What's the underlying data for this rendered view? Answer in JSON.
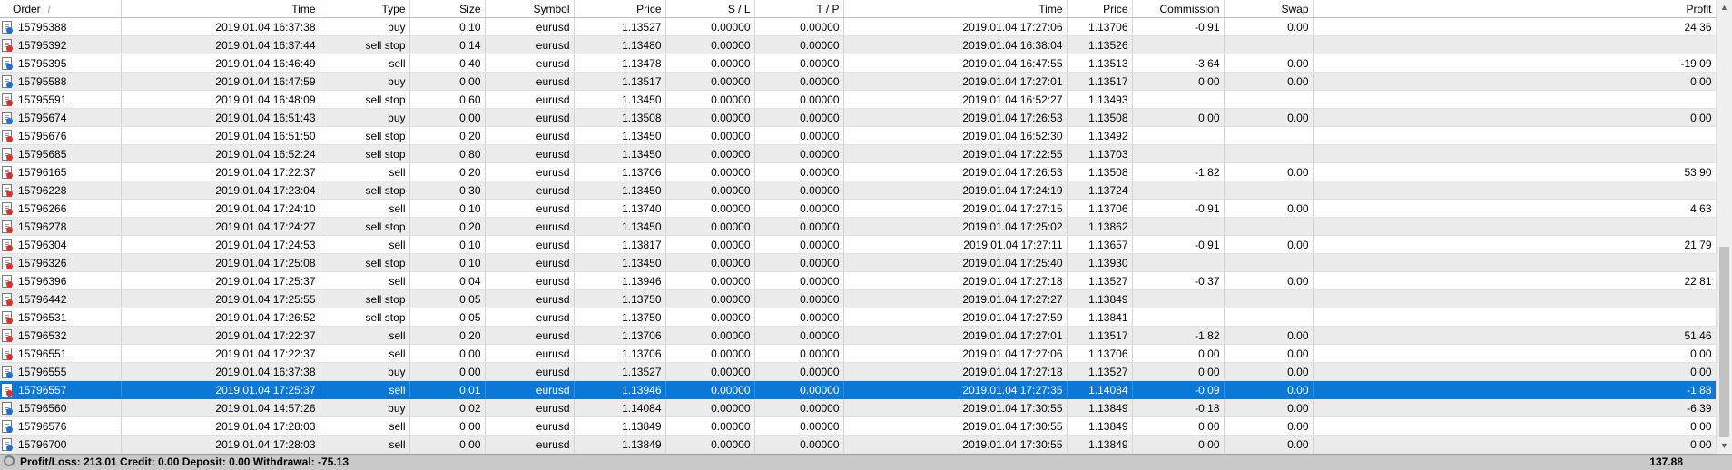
{
  "columns": {
    "order": "Order",
    "sort_indicator": "/",
    "time": "Time",
    "type": "Type",
    "size": "Size",
    "symbol": "Symbol",
    "price": "Price",
    "sl": "S / L",
    "tp": "T / P",
    "close_time": "Time",
    "close_price": "Price",
    "commission": "Commission",
    "swap": "Swap",
    "profit": "Profit"
  },
  "rows": [
    {
      "side": "buy",
      "order": "15795388",
      "time": "2019.01.04 16:37:38",
      "type": "buy",
      "size": "0.10",
      "symbol": "eurusd",
      "price": "1.13527",
      "sl": "0.00000",
      "tp": "0.00000",
      "close_time": "2019.01.04 17:27:06",
      "close_price": "1.13706",
      "commission": "-0.91",
      "swap": "0.00",
      "profit": "24.36"
    },
    {
      "side": "sell",
      "order": "15795392",
      "time": "2019.01.04 16:37:44",
      "type": "sell stop",
      "size": "0.14",
      "symbol": "eurusd",
      "price": "1.13480",
      "sl": "0.00000",
      "tp": "0.00000",
      "close_time": "2019.01.04 16:38:04",
      "close_price": "1.13526",
      "commission": "",
      "swap": "",
      "profit": ""
    },
    {
      "side": "buy",
      "order": "15795395",
      "time": "2019.01.04 16:46:49",
      "type": "sell",
      "size": "0.40",
      "symbol": "eurusd",
      "price": "1.13478",
      "sl": "0.00000",
      "tp": "0.00000",
      "close_time": "2019.01.04 16:47:55",
      "close_price": "1.13513",
      "commission": "-3.64",
      "swap": "0.00",
      "profit": "-19.09"
    },
    {
      "side": "buy",
      "order": "15795588",
      "time": "2019.01.04 16:47:59",
      "type": "buy",
      "size": "0.00",
      "symbol": "eurusd",
      "price": "1.13517",
      "sl": "0.00000",
      "tp": "0.00000",
      "close_time": "2019.01.04 17:27:01",
      "close_price": "1.13517",
      "commission": "0.00",
      "swap": "0.00",
      "profit": "0.00"
    },
    {
      "side": "sell",
      "order": "15795591",
      "time": "2019.01.04 16:48:09",
      "type": "sell stop",
      "size": "0.60",
      "symbol": "eurusd",
      "price": "1.13450",
      "sl": "0.00000",
      "tp": "0.00000",
      "close_time": "2019.01.04 16:52:27",
      "close_price": "1.13493",
      "commission": "",
      "swap": "",
      "profit": ""
    },
    {
      "side": "buy",
      "order": "15795674",
      "time": "2019.01.04 16:51:43",
      "type": "buy",
      "size": "0.00",
      "symbol": "eurusd",
      "price": "1.13508",
      "sl": "0.00000",
      "tp": "0.00000",
      "close_time": "2019.01.04 17:26:53",
      "close_price": "1.13508",
      "commission": "0.00",
      "swap": "0.00",
      "profit": "0.00"
    },
    {
      "side": "sell",
      "order": "15795676",
      "time": "2019.01.04 16:51:50",
      "type": "sell stop",
      "size": "0.20",
      "symbol": "eurusd",
      "price": "1.13450",
      "sl": "0.00000",
      "tp": "0.00000",
      "close_time": "2019.01.04 16:52:30",
      "close_price": "1.13492",
      "commission": "",
      "swap": "",
      "profit": ""
    },
    {
      "side": "sell",
      "order": "15795685",
      "time": "2019.01.04 16:52:24",
      "type": "sell stop",
      "size": "0.80",
      "symbol": "eurusd",
      "price": "1.13450",
      "sl": "0.00000",
      "tp": "0.00000",
      "close_time": "2019.01.04 17:22:55",
      "close_price": "1.13703",
      "commission": "",
      "swap": "",
      "profit": ""
    },
    {
      "side": "sell",
      "order": "15796165",
      "time": "2019.01.04 17:22:37",
      "type": "sell",
      "size": "0.20",
      "symbol": "eurusd",
      "price": "1.13706",
      "sl": "0.00000",
      "tp": "0.00000",
      "close_time": "2019.01.04 17:26:53",
      "close_price": "1.13508",
      "commission": "-1.82",
      "swap": "0.00",
      "profit": "53.90"
    },
    {
      "side": "sell",
      "order": "15796228",
      "time": "2019.01.04 17:23:04",
      "type": "sell stop",
      "size": "0.30",
      "symbol": "eurusd",
      "price": "1.13450",
      "sl": "0.00000",
      "tp": "0.00000",
      "close_time": "2019.01.04 17:24:19",
      "close_price": "1.13724",
      "commission": "",
      "swap": "",
      "profit": ""
    },
    {
      "side": "sell",
      "order": "15796266",
      "time": "2019.01.04 17:24:10",
      "type": "sell",
      "size": "0.10",
      "symbol": "eurusd",
      "price": "1.13740",
      "sl": "0.00000",
      "tp": "0.00000",
      "close_time": "2019.01.04 17:27:15",
      "close_price": "1.13706",
      "commission": "-0.91",
      "swap": "0.00",
      "profit": "4.63"
    },
    {
      "side": "sell",
      "order": "15796278",
      "time": "2019.01.04 17:24:27",
      "type": "sell stop",
      "size": "0.20",
      "symbol": "eurusd",
      "price": "1.13450",
      "sl": "0.00000",
      "tp": "0.00000",
      "close_time": "2019.01.04 17:25:02",
      "close_price": "1.13862",
      "commission": "",
      "swap": "",
      "profit": ""
    },
    {
      "side": "sell",
      "order": "15796304",
      "time": "2019.01.04 17:24:53",
      "type": "sell",
      "size": "0.10",
      "symbol": "eurusd",
      "price": "1.13817",
      "sl": "0.00000",
      "tp": "0.00000",
      "close_time": "2019.01.04 17:27:11",
      "close_price": "1.13657",
      "commission": "-0.91",
      "swap": "0.00",
      "profit": "21.79"
    },
    {
      "side": "sell",
      "order": "15796326",
      "time": "2019.01.04 17:25:08",
      "type": "sell stop",
      "size": "0.10",
      "symbol": "eurusd",
      "price": "1.13450",
      "sl": "0.00000",
      "tp": "0.00000",
      "close_time": "2019.01.04 17:25:40",
      "close_price": "1.13930",
      "commission": "",
      "swap": "",
      "profit": ""
    },
    {
      "side": "sell",
      "order": "15796396",
      "time": "2019.01.04 17:25:37",
      "type": "sell",
      "size": "0.04",
      "symbol": "eurusd",
      "price": "1.13946",
      "sl": "0.00000",
      "tp": "0.00000",
      "close_time": "2019.01.04 17:27:18",
      "close_price": "1.13527",
      "commission": "-0.37",
      "swap": "0.00",
      "profit": "22.81"
    },
    {
      "side": "sell",
      "order": "15796442",
      "time": "2019.01.04 17:25:55",
      "type": "sell stop",
      "size": "0.05",
      "symbol": "eurusd",
      "price": "1.13750",
      "sl": "0.00000",
      "tp": "0.00000",
      "close_time": "2019.01.04 17:27:27",
      "close_price": "1.13849",
      "commission": "",
      "swap": "",
      "profit": ""
    },
    {
      "side": "sell",
      "order": "15796531",
      "time": "2019.01.04 17:26:52",
      "type": "sell stop",
      "size": "0.05",
      "symbol": "eurusd",
      "price": "1.13750",
      "sl": "0.00000",
      "tp": "0.00000",
      "close_time": "2019.01.04 17:27:59",
      "close_price": "1.13841",
      "commission": "",
      "swap": "",
      "profit": ""
    },
    {
      "side": "sell",
      "order": "15796532",
      "time": "2019.01.04 17:22:37",
      "type": "sell",
      "size": "0.20",
      "symbol": "eurusd",
      "price": "1.13706",
      "sl": "0.00000",
      "tp": "0.00000",
      "close_time": "2019.01.04 17:27:01",
      "close_price": "1.13517",
      "commission": "-1.82",
      "swap": "0.00",
      "profit": "51.46"
    },
    {
      "side": "sell",
      "order": "15796551",
      "time": "2019.01.04 17:22:37",
      "type": "sell",
      "size": "0.00",
      "symbol": "eurusd",
      "price": "1.13706",
      "sl": "0.00000",
      "tp": "0.00000",
      "close_time": "2019.01.04 17:27:06",
      "close_price": "1.13706",
      "commission": "0.00",
      "swap": "0.00",
      "profit": "0.00"
    },
    {
      "side": "buy",
      "order": "15796555",
      "time": "2019.01.04 16:37:38",
      "type": "buy",
      "size": "0.00",
      "symbol": "eurusd",
      "price": "1.13527",
      "sl": "0.00000",
      "tp": "0.00000",
      "close_time": "2019.01.04 17:27:18",
      "close_price": "1.13527",
      "commission": "0.00",
      "swap": "0.00",
      "profit": "0.00"
    },
    {
      "side": "sell",
      "selected": true,
      "order": "15796557",
      "time": "2019.01.04 17:25:37",
      "type": "sell",
      "size": "0.01",
      "symbol": "eurusd",
      "price": "1.13946",
      "sl": "0.00000",
      "tp": "0.00000",
      "close_time": "2019.01.04 17:27:35",
      "close_price": "1.14084",
      "commission": "-0.09",
      "swap": "0.00",
      "profit": "-1.88"
    },
    {
      "side": "buy",
      "order": "15796560",
      "time": "2019.01.04 14:57:26",
      "type": "buy",
      "size": "0.02",
      "symbol": "eurusd",
      "price": "1.14084",
      "sl": "0.00000",
      "tp": "0.00000",
      "close_time": "2019.01.04 17:30:55",
      "close_price": "1.13849",
      "commission": "-0.18",
      "swap": "0.00",
      "profit": "-6.39"
    },
    {
      "side": "buy",
      "order": "15796576",
      "time": "2019.01.04 17:28:03",
      "type": "sell",
      "size": "0.00",
      "symbol": "eurusd",
      "price": "1.13849",
      "sl": "0.00000",
      "tp": "0.00000",
      "close_time": "2019.01.04 17:30:55",
      "close_price": "1.13849",
      "commission": "0.00",
      "swap": "0.00",
      "profit": "0.00"
    },
    {
      "side": "buy",
      "order": "15796700",
      "time": "2019.01.04 17:28:03",
      "type": "sell",
      "size": "0.00",
      "symbol": "eurusd",
      "price": "1.13849",
      "sl": "0.00000",
      "tp": "0.00000",
      "close_time": "2019.01.04 17:30:55",
      "close_price": "1.13849",
      "commission": "0.00",
      "swap": "0.00",
      "profit": "0.00"
    }
  ],
  "status": {
    "summary": "Profit/Loss: 213.01  Credit: 0.00  Deposit: 0.00  Withdrawal: -75.13",
    "total": "137.88"
  },
  "colors": {
    "selection": "#0a78d7",
    "buy_icon": "#1a6fd1",
    "sell_icon": "#d8322a"
  }
}
